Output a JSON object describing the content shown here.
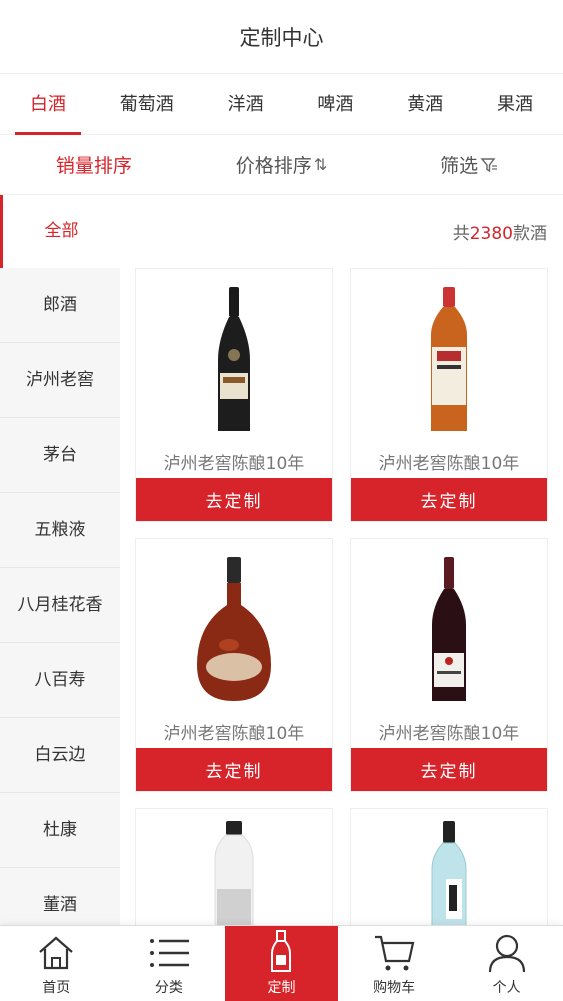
{
  "header": {
    "title": "定制中心"
  },
  "categories": [
    "白酒",
    "葡萄酒",
    "洋酒",
    "啤酒",
    "黄酒",
    "果酒"
  ],
  "sort": {
    "sales": "销量排序",
    "price": "价格排序",
    "price_icon": "⇅",
    "filter": "筛选",
    "filter_icon": "filter-icon"
  },
  "summary": {
    "all": "全部",
    "prefix": "共",
    "count": "2380",
    "suffix": "款酒"
  },
  "sidebar": [
    "郎酒",
    "泸州老窖",
    "茅台",
    "五粮液",
    "八月桂花香",
    "八百寿",
    "白云边",
    "杜康",
    "董酒"
  ],
  "products": [
    {
      "name": "泸州老窖陈酿10年",
      "button": "去定制"
    },
    {
      "name": "泸州老窖陈酿10年",
      "button": "去定制"
    },
    {
      "name": "泸州老窖陈酿10年",
      "button": "去定制"
    },
    {
      "name": "泸州老窖陈酿10年",
      "button": "去定制"
    }
  ],
  "tabbar": [
    "首页",
    "分类",
    "定制",
    "购物车",
    "个人"
  ],
  "colors": {
    "accent": "#d7242b"
  }
}
